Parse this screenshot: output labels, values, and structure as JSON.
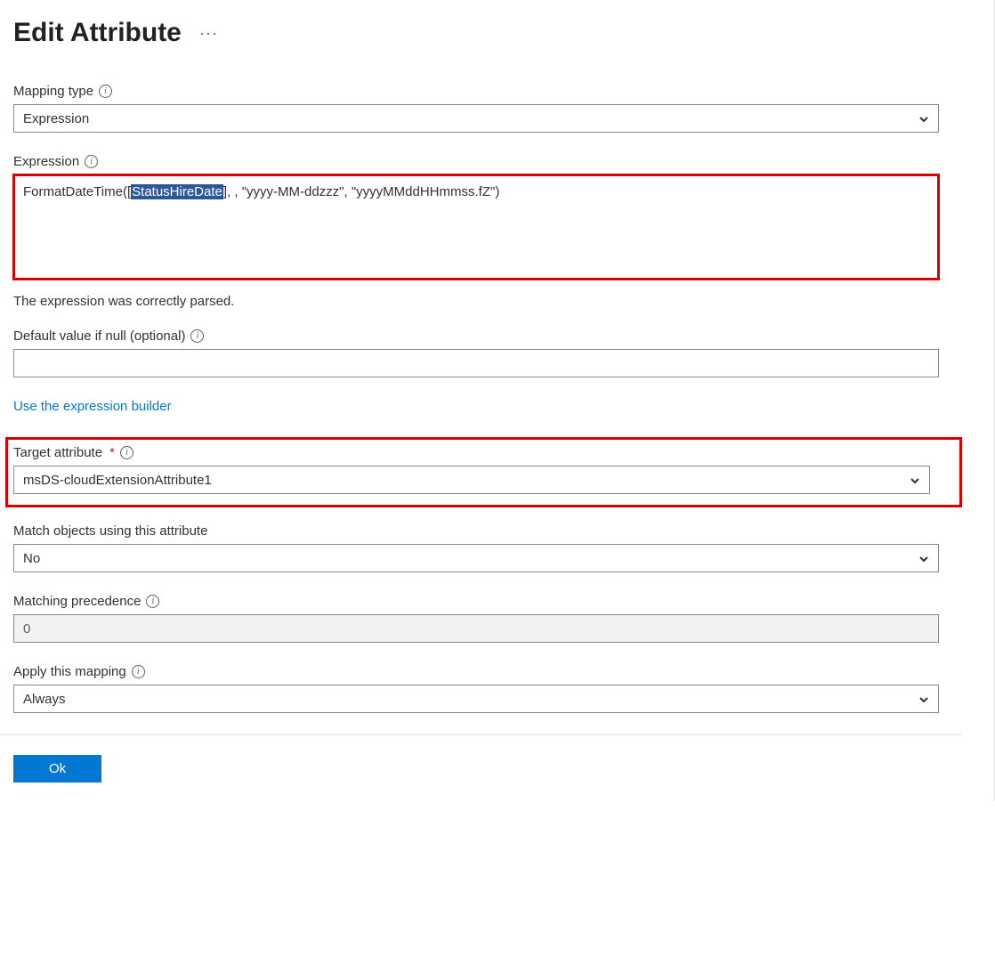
{
  "header": {
    "title": "Edit Attribute"
  },
  "mapping_type": {
    "label": "Mapping type",
    "value": "Expression"
  },
  "expression": {
    "label": "Expression",
    "value_prefix": "FormatDateTime([",
    "value_highlight": "StatusHireDate",
    "value_suffix": "], , \"yyyy-MM-ddzzz\", \"yyyyMMddHHmmss.fZ\")",
    "status": "The expression was correctly parsed."
  },
  "default_value": {
    "label": "Default value if null (optional)",
    "value": ""
  },
  "link": {
    "builder": "Use the expression builder"
  },
  "target_attribute": {
    "label": "Target attribute",
    "value": "msDS-cloudExtensionAttribute1"
  },
  "match_objects": {
    "label": "Match objects using this attribute",
    "value": "No"
  },
  "matching_precedence": {
    "label": "Matching precedence",
    "value": "0"
  },
  "apply_mapping": {
    "label": "Apply this mapping",
    "value": "Always"
  },
  "footer": {
    "ok": "Ok"
  }
}
